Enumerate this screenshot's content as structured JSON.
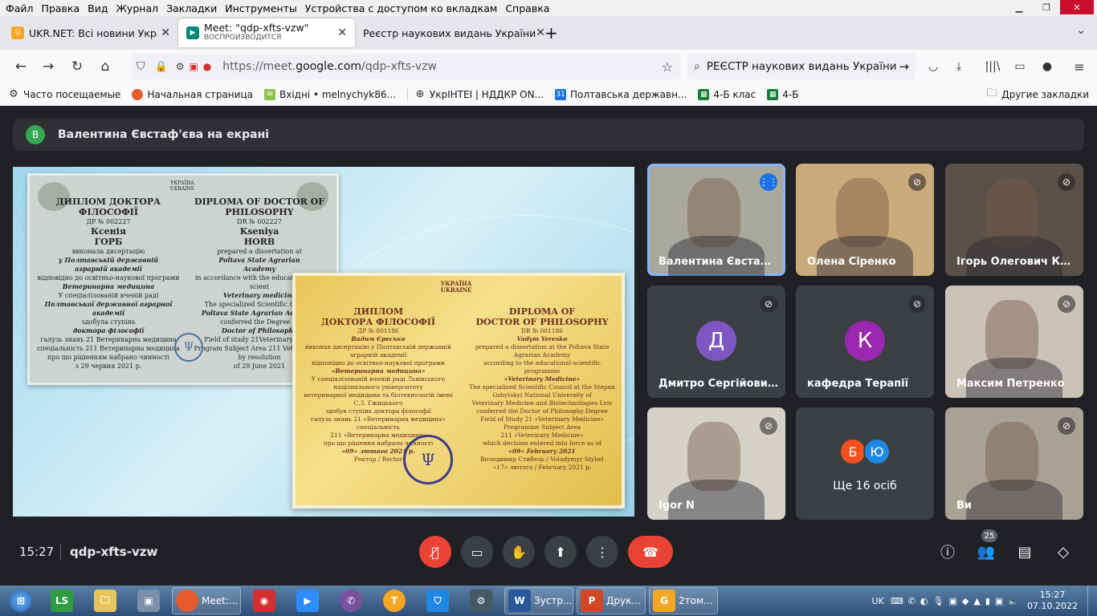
{
  "menu": [
    "Файл",
    "Правка",
    "Вид",
    "Журнал",
    "Закладки",
    "Инструменты",
    "Устройства с доступом ко вкладкам",
    "Справка"
  ],
  "tabs": [
    {
      "title": "UKR.NET: Всі новини України, с",
      "subtitle": "",
      "active": false,
      "fav_color": "#f5a623"
    },
    {
      "title": "Meet: \"qdp-xfts-vzw\"",
      "subtitle": "ВОСПРОИЗВОДИТСЯ",
      "active": true,
      "fav_color": "#00897b"
    },
    {
      "title": "Реєстр наукових видань України",
      "subtitle": "",
      "active": false,
      "fav_color": ""
    }
  ],
  "url": {
    "prefix": "https://meet.",
    "host": "google.com",
    "path": "/qdp-xfts-vzw"
  },
  "search_text": "РЕЄСТР наукових видань України",
  "bookmarks": [
    {
      "label": "Часто посещаемые",
      "icon": "gear-icon",
      "color": ""
    },
    {
      "label": "Начальная страница",
      "icon": "firefox-icon",
      "color": "#e55b2d"
    },
    {
      "label": "Вхідні • melnychyk86...",
      "icon": "mail-icon",
      "color": "#8bc34a"
    },
    {
      "label": "УкрІНТЕІ | НДДКР ON...",
      "icon": "globe-icon",
      "color": ""
    },
    {
      "label": "Полтавська державн...",
      "icon": "calendar-icon",
      "color": "#1a73e8"
    },
    {
      "label": "4-Б клас",
      "icon": "classroom-icon",
      "color": "#188038"
    },
    {
      "label": "4-Б",
      "icon": "classroom-icon",
      "color": "#188038"
    }
  ],
  "other_bookmarks": "Другие закладки",
  "presenting": {
    "avatar": "В",
    "text": "Валентина Євстаф'єва на екрані"
  },
  "diploma1": {
    "country": "УКРАЇНА\nUKRAINE",
    "left": [
      "ДИПЛОМ ДОКТОРА",
      "ФІЛОСОФІЇ",
      "ДР № 002227",
      "Ксенія",
      "ГОРБ",
      "виконала дисертацію",
      "у Полтавській державній",
      "аграрній академії",
      "відповідно до освітньо-наукової програми",
      "Ветеринарна медицина",
      "У спеціалізованій вченій раді",
      "Полтавської державної аграрної академії",
      "здобула ступінь",
      "доктора філософії",
      "галузь знань 21 Ветеринарна медицина",
      "спеціальність 211 Ветеринарна медицина",
      "про що рішенням набрано чинності",
      "з 29 червня 2021 р."
    ],
    "right": [
      "DIPLOMA OF DOCTOR OF",
      "PHILOSOPHY",
      "DR № 002227",
      "Kseniya",
      "HORB",
      "prepared a dissertation at",
      "Poltava State Agrarian",
      "Academy",
      "in accordance with the educational and scient",
      "Veterinary medicine",
      "The specialized Scientific Council",
      "Poltava State Agrarian Academy",
      "conferred the Degree of",
      "Doctor of Philosophy",
      "Field of study 21Veterinary medic",
      "Program Subject Area 211 Veterinary m",
      "by resolution",
      "of 29 June 2021"
    ]
  },
  "diploma2": {
    "country": "УКРАЇНА\nUKRAINE",
    "left": [
      "ДИПЛОМ",
      "ДОКТОРА ФІЛОСОФІЇ",
      "ДР № 001186",
      "Вадим Єресько",
      "виконав дисертацію у Полтавській державній аграрній академії",
      "відповідно до освітньо-наукової програми",
      "«Ветеринарна медицина»",
      "У спеціалізованій вченій раді Львівського національного університету",
      "ветеринарної медицини та біотехнологій імені С.З. Гжицького",
      "здобув ступінь доктора філософії",
      "галузь знань 21 «Ветеринарна медицина»",
      "спеціальність",
      "211 «Ветеринарна медицина»",
      "про що рішення набрало чинності",
      "«09» лютого 2021 р.",
      "Ректор / Rector"
    ],
    "right": [
      "DIPLOMA OF",
      "DOCTOR OF PHILOSOPHY",
      "DR № 001186",
      "Vadym Yeresko",
      "prepared a dissertation at the Poltava State Agrarian Academy",
      "according to the educational-scientific programme",
      "«Veterinary Medicine»",
      "The specialized Scientific Council at the Stepan Gzhytskyi National University of",
      "Veterinary Medicine and Biotechnologies Lviv",
      "conferred the Doctor of Philosophy Degree",
      "Field of Study 21 «Veterinary Medicine»",
      "Programme Subject Area",
      "211 «Veterinary Medicine»",
      "which decision entered into force as of",
      "«09» February 2021",
      "Володимир Стибель / Volodymyr Stybel",
      "«17» лютого / February 2021 р."
    ]
  },
  "participants": [
    {
      "name": "Валентина Євстаф...",
      "muted": false,
      "speaking": true,
      "type": "video",
      "bg": "#a9a89c",
      "avatar": "",
      "avatar_color": ""
    },
    {
      "name": "Олена Сіренко",
      "muted": true,
      "speaking": false,
      "type": "video",
      "bg": "#c9aa7a",
      "avatar": "",
      "avatar_color": ""
    },
    {
      "name": "Ігорь Олегович Ко...",
      "muted": true,
      "speaking": false,
      "type": "video",
      "bg": "#5a5148",
      "avatar": "",
      "avatar_color": ""
    },
    {
      "name": "Дмитро Сергійови...",
      "muted": true,
      "speaking": false,
      "type": "avatar",
      "bg": "#3c4043",
      "avatar": "Д",
      "avatar_color": "#7e57c2"
    },
    {
      "name": "кафедра Терапії",
      "muted": true,
      "speaking": false,
      "type": "avatar",
      "bg": "#3c4043",
      "avatar": "К",
      "avatar_color": "#9c27b0"
    },
    {
      "name": "Максим Петренко",
      "muted": true,
      "speaking": false,
      "type": "video",
      "bg": "#c9c2b6",
      "avatar": "",
      "avatar_color": ""
    },
    {
      "name": "Igor N",
      "muted": true,
      "speaking": false,
      "type": "video",
      "bg": "#d4d2c8",
      "avatar": "",
      "avatar_color": ""
    },
    {
      "name": "Ще 16 осіб",
      "muted": false,
      "speaking": false,
      "type": "more",
      "bg": "#3c4043",
      "avatar": "",
      "avatar_color": ""
    },
    {
      "name": "Ви",
      "muted": true,
      "speaking": false,
      "type": "video",
      "bg": "#a8a294",
      "avatar": "",
      "avatar_color": ""
    }
  ],
  "more_avatars": [
    {
      "letter": "Б",
      "color": "#f4511e"
    },
    {
      "letter": "Ю",
      "color": "#1e88e5"
    }
  ],
  "bottom": {
    "time": "15:27",
    "code": "qdp-xfts-vzw",
    "participant_count": "25"
  },
  "taskbar": {
    "apps": [
      {
        "label": "Meet:...",
        "color": "#e55b2d",
        "wide": true
      },
      {
        "label": "Зустр...",
        "color": "#2b579a",
        "wide": true
      },
      {
        "label": "Друк...",
        "color": "#d24726",
        "wide": true
      },
      {
        "label": "2том...",
        "color": "#f5a623",
        "wide": true
      }
    ],
    "lang": "UK",
    "time": "15:27",
    "date": "07.10.2022"
  }
}
